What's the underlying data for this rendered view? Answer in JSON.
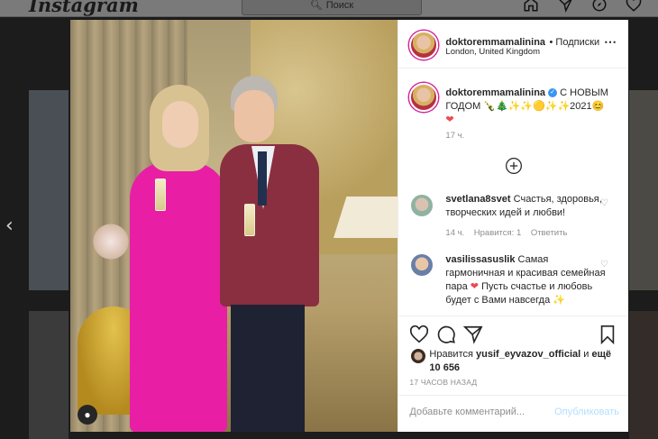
{
  "topbar": {
    "logo": "Instagram",
    "search_placeholder": "Поиск"
  },
  "post": {
    "author": "doktoremmamalinina",
    "follow_label": "Подписки",
    "location": "London, United Kingdom",
    "caption_text": "С НОВЫМ ГОДОМ",
    "caption_year": "2021",
    "caption_time": "17 ч.",
    "likes_prefix": "Нравится",
    "liked_by": "yusif_eyvazov_official",
    "likes_connector": "и",
    "likes_more": "ещё 10 656",
    "timestamp": "17 ЧАСОВ НАЗАД"
  },
  "comments": [
    {
      "user": "svetlana8svet",
      "text": "Счастья, здоровья, творческих идей и любви!",
      "time": "14 ч.",
      "likes": "Нравится: 1",
      "reply": "Ответить"
    },
    {
      "user": "vasilissasuslik",
      "text_a": "Самая гармоничная и красивая семейная пара",
      "text_b": "Пусть счастье и любовь будет с Вами навсегда"
    }
  ],
  "composer": {
    "placeholder": "Добавьте комментарий...",
    "publish_label": "Опубликовать"
  },
  "colors": {
    "accent": "#0095f6",
    "heart": "#ed4956",
    "dress": "#e81ea5",
    "jacket": "#8a2f3f"
  },
  "icons": [
    "search-icon",
    "home-icon",
    "direct-icon",
    "explore-icon",
    "activity-icon",
    "avatar",
    "more-icon",
    "verified-icon",
    "plus-circle-icon",
    "heart-icon",
    "comment-icon",
    "share-icon",
    "bookmark-icon",
    "user-tag-icon",
    "chevron-left-icon"
  ]
}
